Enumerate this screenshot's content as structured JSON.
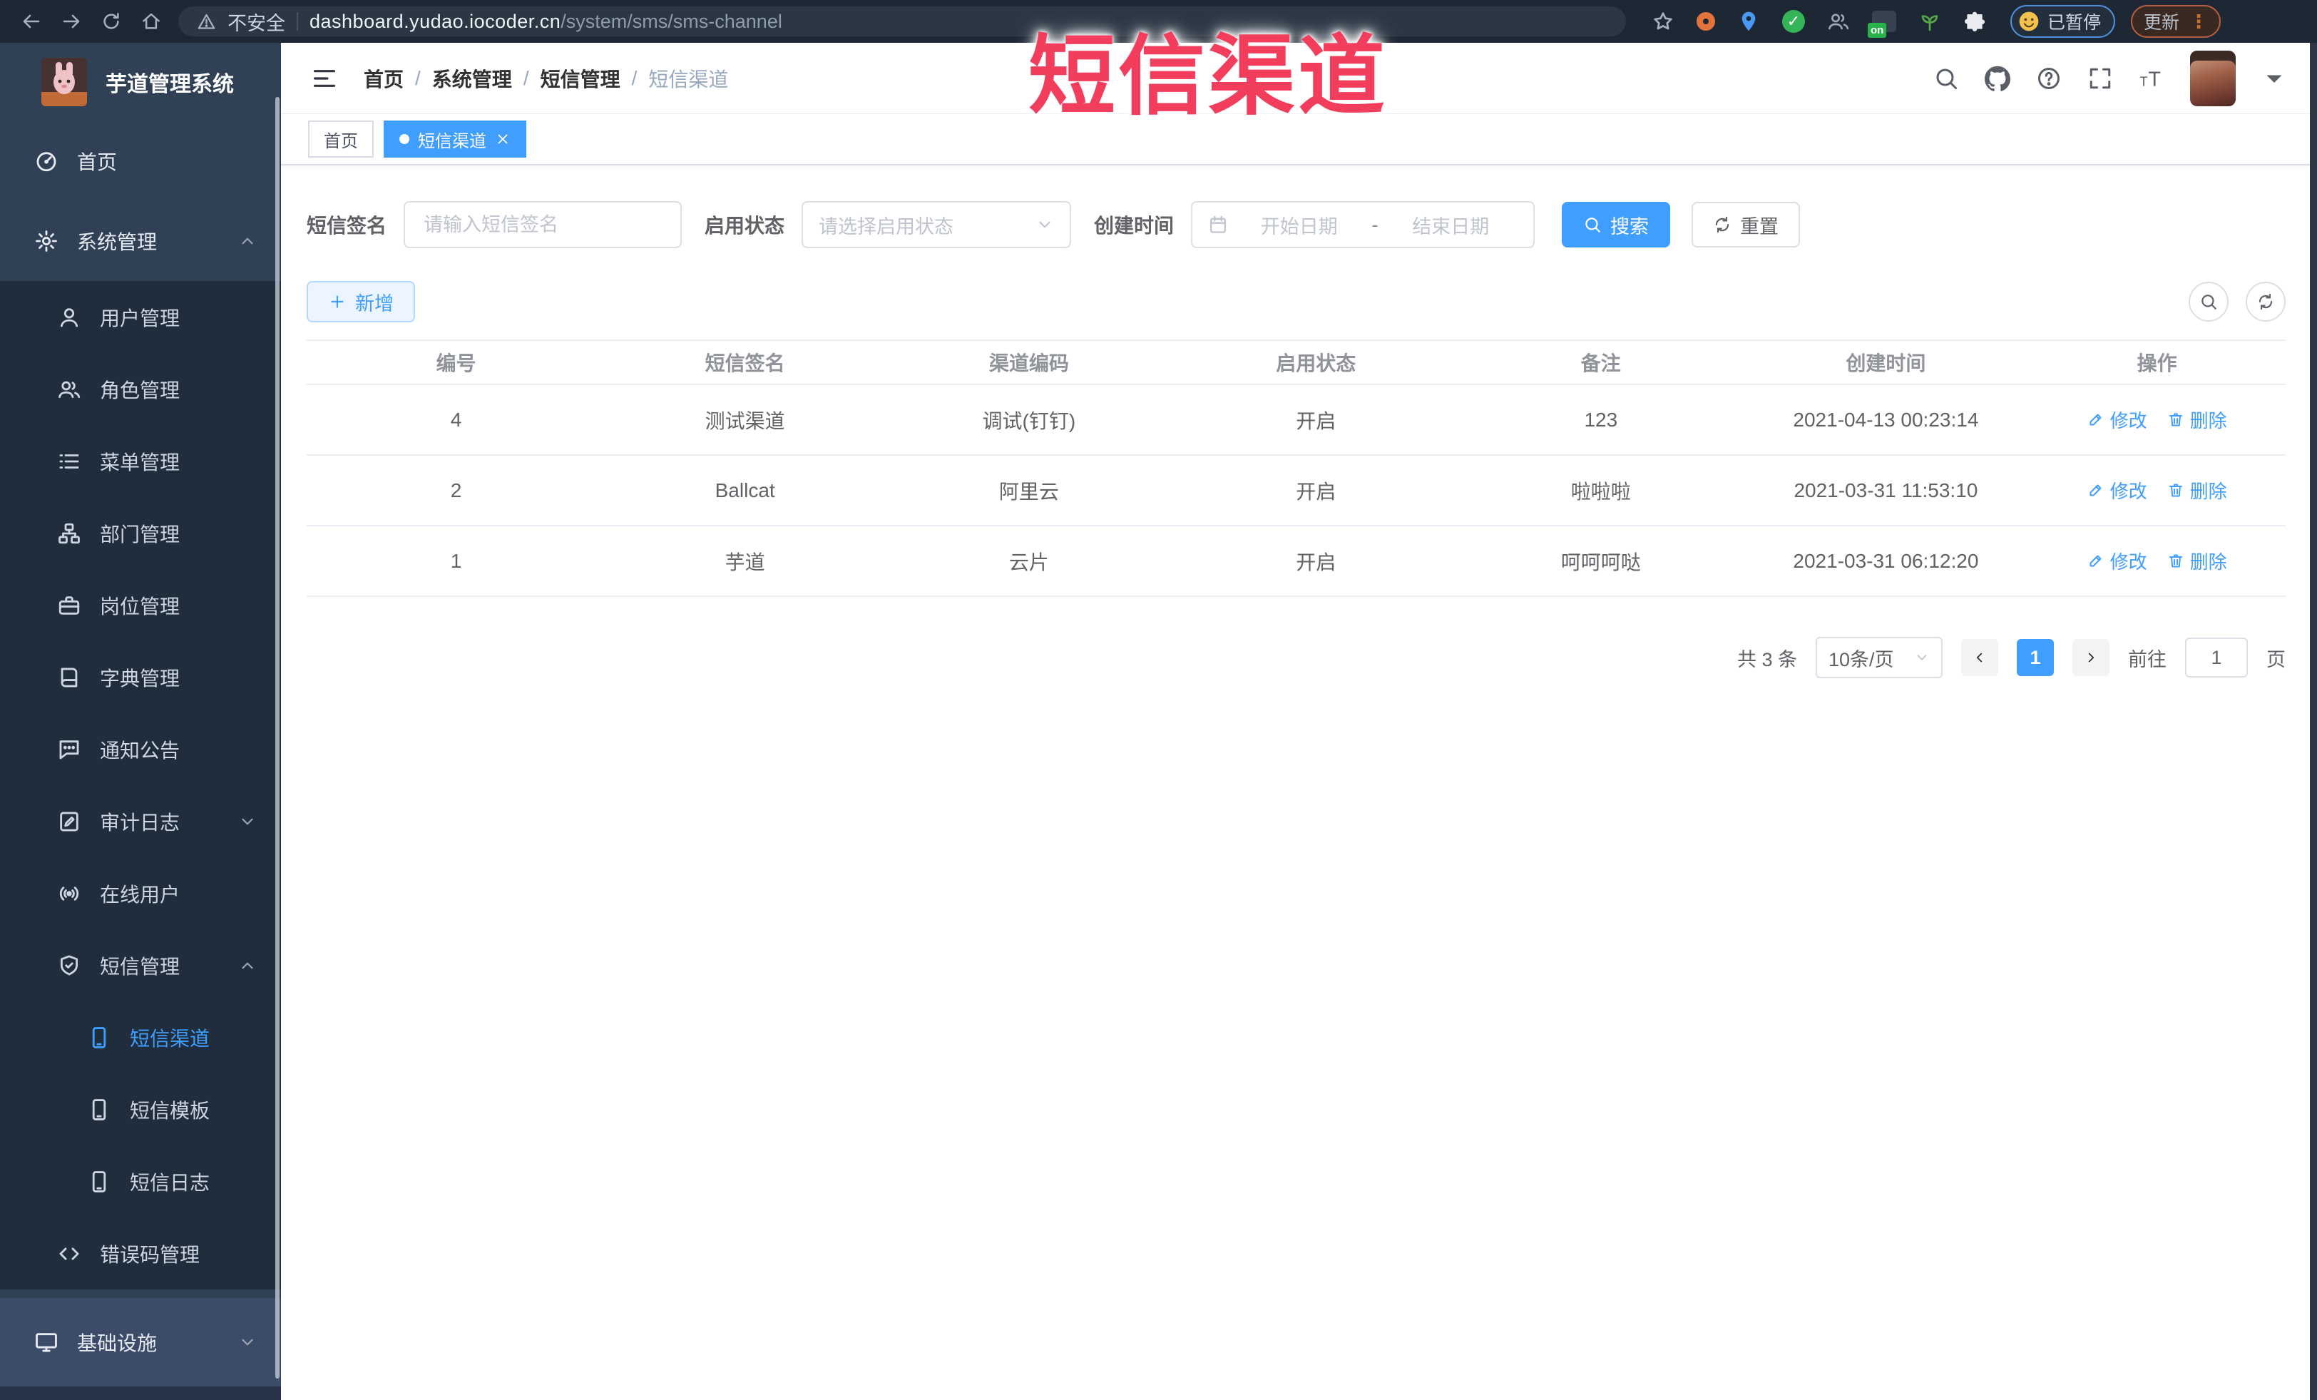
{
  "browser": {
    "security_label": "不安全",
    "url_domain": "dashboard.yudao.iocoder.cn",
    "url_path": "/system/sms/sms-channel",
    "ext_badge": "on",
    "paused_badge": "已暂停",
    "update_button": "更新",
    "menu_dots": "⋮"
  },
  "watermark": "短信渠道",
  "sidebar": {
    "title": "芋道管理系统",
    "items": [
      {
        "label": "首页",
        "icon": "dashboard",
        "level": 1
      },
      {
        "label": "系统管理",
        "icon": "gear",
        "level": 1,
        "arrow": "up"
      },
      {
        "label": "用户管理",
        "icon": "user",
        "level": 2
      },
      {
        "label": "角色管理",
        "icon": "users",
        "level": 2
      },
      {
        "label": "菜单管理",
        "icon": "list",
        "level": 2
      },
      {
        "label": "部门管理",
        "icon": "tree",
        "level": 2
      },
      {
        "label": "岗位管理",
        "icon": "briefcase",
        "level": 2
      },
      {
        "label": "字典管理",
        "icon": "book",
        "level": 2
      },
      {
        "label": "通知公告",
        "icon": "chat",
        "level": 2
      },
      {
        "label": "审计日志",
        "icon": "journal",
        "level": 2,
        "arrow": "down"
      },
      {
        "label": "在线用户",
        "icon": "online",
        "level": 2
      },
      {
        "label": "短信管理",
        "icon": "shield",
        "level": 2,
        "arrow": "up"
      },
      {
        "label": "短信渠道",
        "icon": "phone",
        "level": 3,
        "active": true
      },
      {
        "label": "短信模板",
        "icon": "phone",
        "level": 3
      },
      {
        "label": "短信日志",
        "icon": "phone",
        "level": 3
      },
      {
        "label": "错误码管理",
        "icon": "code",
        "level": 2
      },
      {
        "label": "基础设施",
        "icon": "monitor",
        "level": 1,
        "arrow": "down",
        "highlighted": true
      }
    ]
  },
  "header": {
    "breadcrumb": [
      "首页",
      "系统管理",
      "短信管理",
      "短信渠道"
    ]
  },
  "tags": [
    {
      "label": "首页",
      "active": false,
      "closable": false
    },
    {
      "label": "短信渠道",
      "active": true,
      "closable": true
    }
  ],
  "filters": {
    "signature_label": "短信签名",
    "signature_placeholder": "请输入短信签名",
    "status_label": "启用状态",
    "status_placeholder": "请选择启用状态",
    "time_label": "创建时间",
    "date_start_placeholder": "开始日期",
    "date_separator": "-",
    "date_end_placeholder": "结束日期",
    "search_label": "搜索",
    "reset_label": "重置"
  },
  "toolbar": {
    "add_label": "新增"
  },
  "table": {
    "columns": [
      "编号",
      "短信签名",
      "渠道编码",
      "启用状态",
      "备注",
      "创建时间",
      "操作"
    ],
    "rows": [
      {
        "id": "4",
        "signature": "测试渠道",
        "code": "调试(钉钉)",
        "status": "开启",
        "remark": "123",
        "created_at": "2021-04-13 00:23:14"
      },
      {
        "id": "2",
        "signature": "Ballcat",
        "code": "阿里云",
        "status": "开启",
        "remark": "啦啦啦",
        "created_at": "2021-03-31 11:53:10"
      },
      {
        "id": "1",
        "signature": "芋道",
        "code": "云片",
        "status": "开启",
        "remark": "呵呵呵哒",
        "created_at": "2021-03-31 06:12:20"
      }
    ],
    "edit_label": "修改",
    "delete_label": "删除"
  },
  "pagination": {
    "total_text": "共 3 条",
    "page_size": "10条/页",
    "current_page": "1",
    "goto_label": "前往",
    "goto_value": "1",
    "page_unit": "页"
  },
  "colors": {
    "accent": "#409EFF",
    "sidebar_bg": "#304156",
    "submenu_bg": "#1F2D3D",
    "tag_active": "#409EFF",
    "watermark": "#F23D5D"
  }
}
